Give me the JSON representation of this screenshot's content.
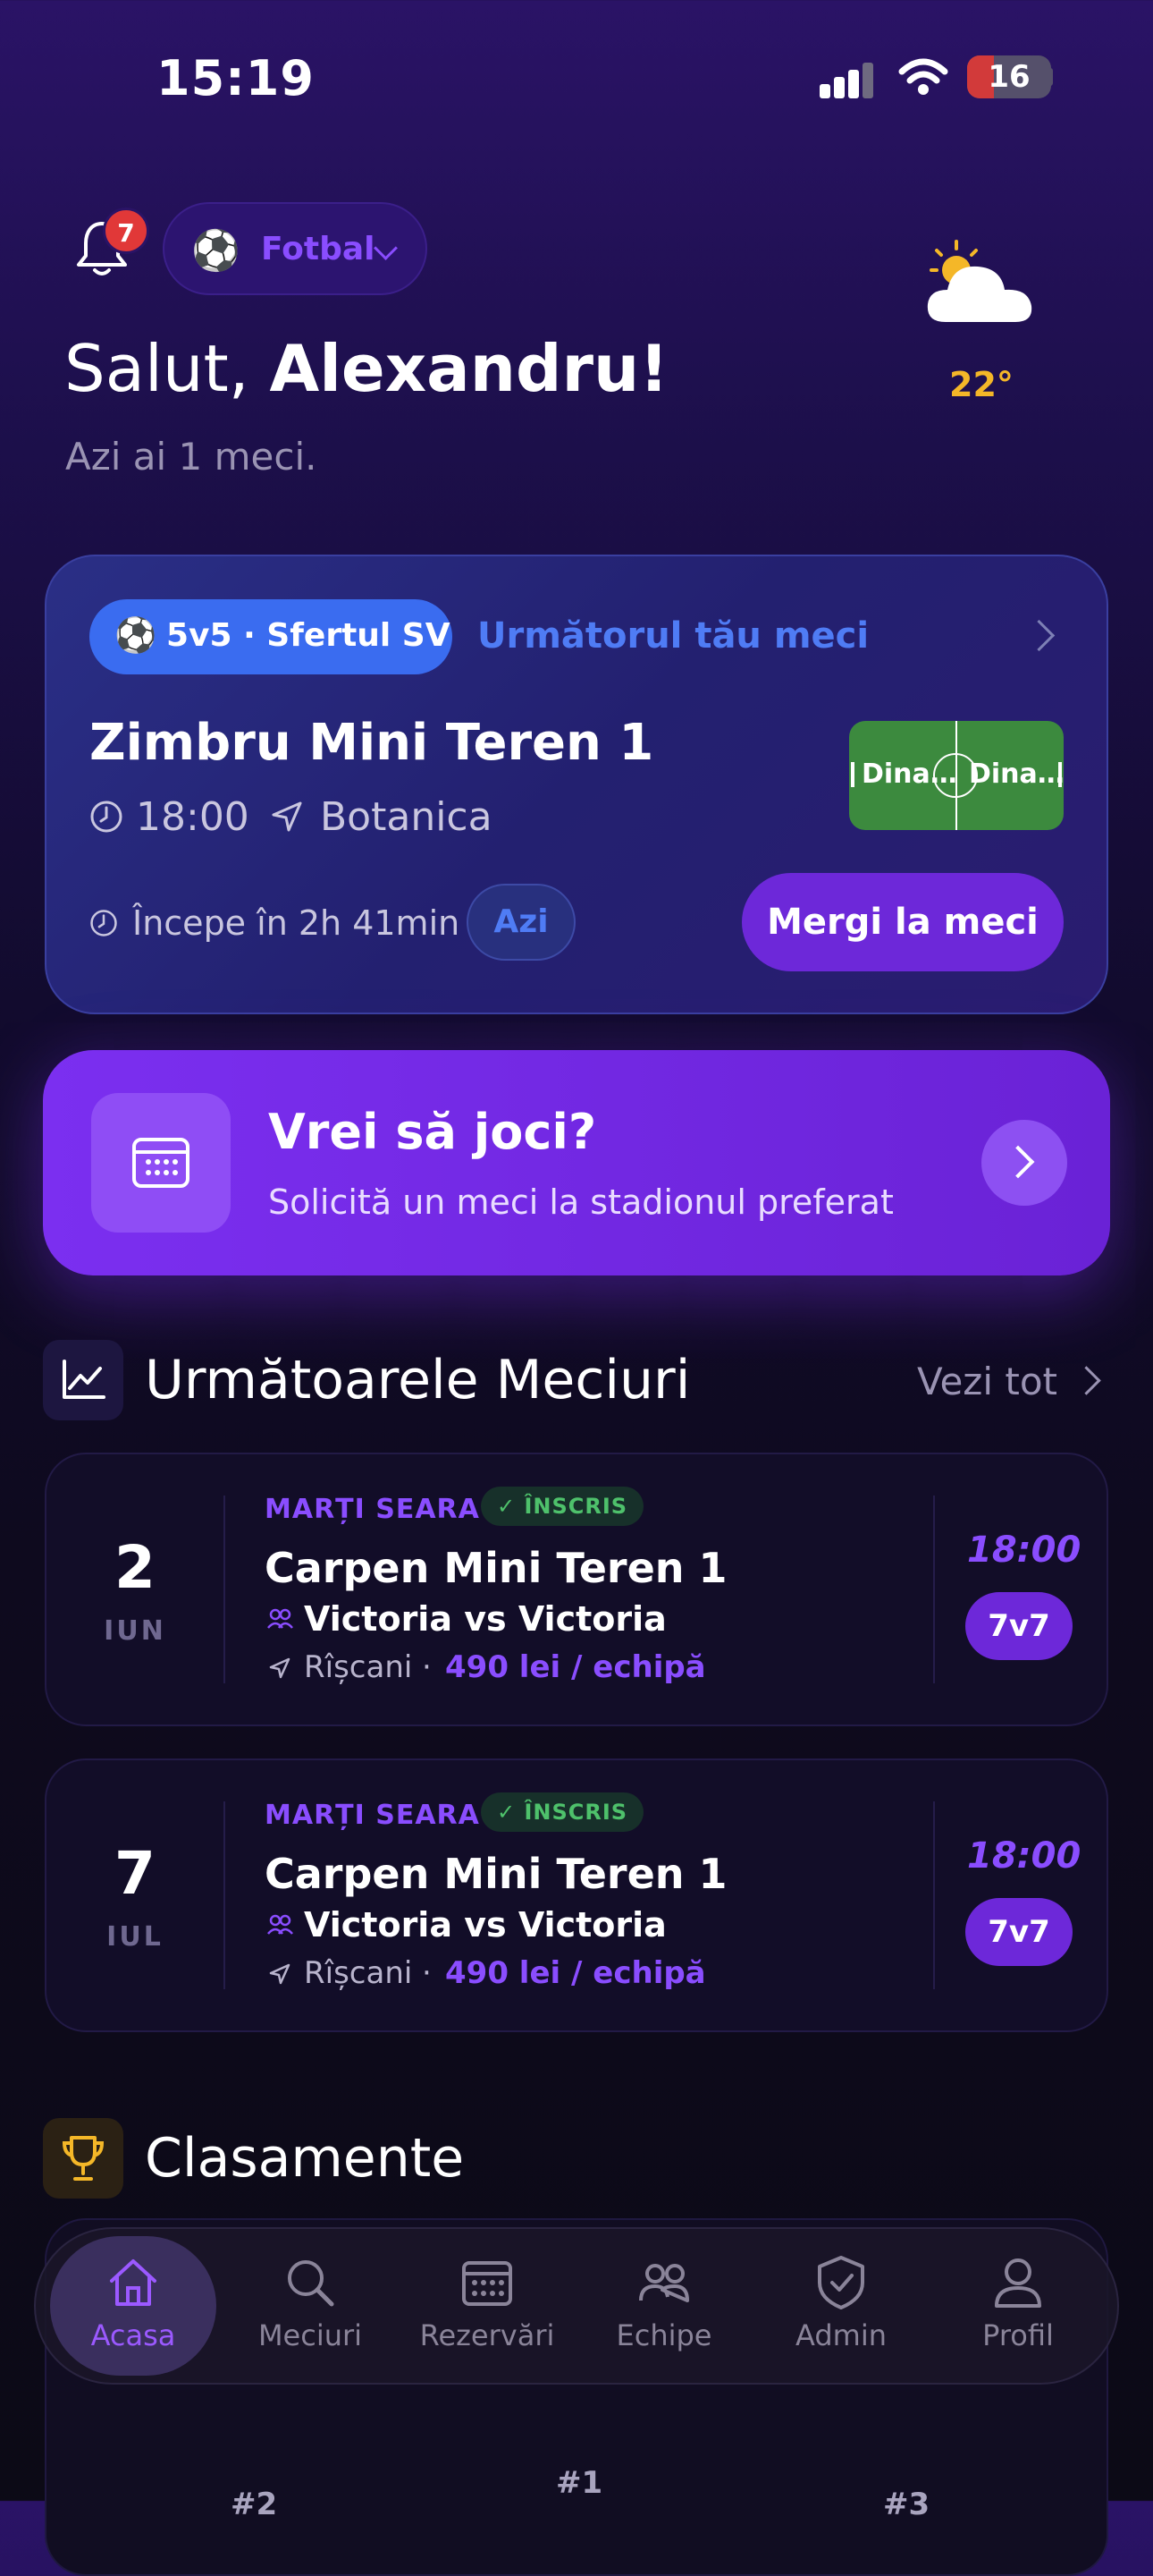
{
  "status": {
    "time": "15:19",
    "battery": "16"
  },
  "header": {
    "notifications": "7",
    "sport": "Fotbal",
    "greeting_prefix": "Salut, ",
    "greeting_name": "Alexandru!",
    "subtitle": "Azi ai 1 meci.",
    "temperature": "22°"
  },
  "next_match": {
    "tag": "5v5 · Sfertul SV",
    "label": "Următorul tău meci",
    "venue": "Zimbru Mini Teren 1",
    "time": "18:00",
    "location": "Botanica",
    "team_left": "Dina…",
    "team_right": "Dina…",
    "starts_in": "Începe în 2h 41min",
    "day_badge": "Azi",
    "button": "Mergi la meci"
  },
  "cta": {
    "title": "Vrei să joci?",
    "subtitle": "Solicită un meci la stadionul preferat"
  },
  "upcoming": {
    "title": "Următoarele Meciuri",
    "see_all": "Vezi tot",
    "matches": [
      {
        "day": "2",
        "month": "IUN",
        "when": "MARȚI SEARA",
        "status": "✓ ÎNSCRIS",
        "venue": "Carpen Mini Teren 1",
        "teams": "Victoria vs Victoria",
        "location": "Rîșcani",
        "price": "490 lei / echipă",
        "hour": "18:00",
        "format": "7v7"
      },
      {
        "day": "7",
        "month": "IUL",
        "when": "MARȚI SEARA",
        "status": "✓ ÎNSCRIS",
        "venue": "Carpen Mini Teren 1",
        "teams": "Victoria vs Victoria",
        "location": "Rîșcani",
        "price": "490 lei / echipă",
        "hour": "18:00",
        "format": "7v7"
      }
    ]
  },
  "standings": {
    "title": "Clasamente",
    "ranks": [
      "#2",
      "#1",
      "#3"
    ]
  },
  "tabs": [
    {
      "label": "Acasa",
      "icon": "home-icon"
    },
    {
      "label": "Meciuri",
      "icon": "search-icon"
    },
    {
      "label": "Rezervări",
      "icon": "calendar-icon"
    },
    {
      "label": "Echipe",
      "icon": "team-icon"
    },
    {
      "label": "Admin",
      "icon": "shield-icon"
    },
    {
      "label": "Profil",
      "icon": "user-icon"
    }
  ],
  "colors": {
    "accent": "#6d28d9",
    "accent_text": "#8a4dff",
    "blue": "#3a6cf0",
    "temp": "#f4b728",
    "badge": "#e13838"
  }
}
